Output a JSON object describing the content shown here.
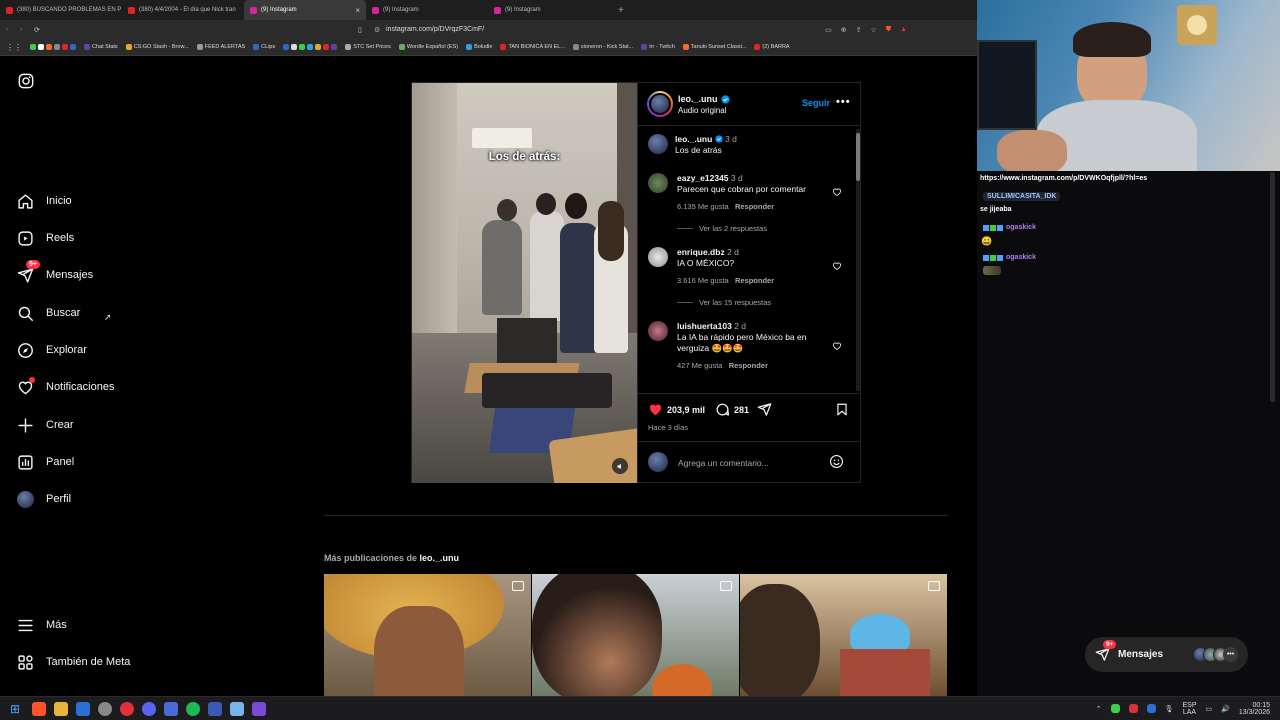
{
  "browser": {
    "tabs": [
      {
        "label": "(380) BUSCANDO PROBLEMAS EN P",
        "color": "#e02424"
      },
      {
        "label": "(380) 4/4/2004 - El día que Nick tran",
        "color": "#e02424"
      },
      {
        "label": "(9) Instagram",
        "color": "#d6249f",
        "active": true,
        "close": "×"
      },
      {
        "label": "(9) Instagram",
        "color": "#d6249f"
      },
      {
        "label": "(9) Instagram",
        "color": "#d6249f"
      }
    ],
    "new_tab": "+",
    "url": "instagram.com/p/DVrqzF3CmF/",
    "bookmarks": [
      "Chat Stats",
      "CS:GO Stash - Brow...",
      "FEED ALERTAS",
      "CLips",
      "STC Set Prices",
      "Wordle Español (ES)",
      "Boludle",
      "TAN BIONICA EN EL...",
      "sioneron - Kick Stat...",
      "trr - Twitch",
      "Tanuki Sunset Classi...",
      "(2) BARRA"
    ]
  },
  "sidebar": {
    "items": [
      {
        "label": "Inicio",
        "icon": "home-icon"
      },
      {
        "label": "Reels",
        "icon": "reels-icon"
      },
      {
        "label": "Mensajes",
        "icon": "messages-icon",
        "badge": "9+"
      },
      {
        "label": "Buscar",
        "icon": "search-icon"
      },
      {
        "label": "Explorar",
        "icon": "explore-icon"
      },
      {
        "label": "Notificaciones",
        "icon": "heart-icon"
      },
      {
        "label": "Crear",
        "icon": "plus-icon"
      },
      {
        "label": "Panel",
        "icon": "chart-icon"
      },
      {
        "label": "Perfil",
        "icon": "avatar"
      }
    ],
    "more": "Más",
    "meta": "También de Meta"
  },
  "post": {
    "overlay_text": "Los de atrás:",
    "author": "leo._.unu",
    "audio": "Audio original",
    "follow": "Seguir",
    "caption": {
      "user": "leo._.unu",
      "time": "3 d",
      "text": "Los de atrás"
    },
    "comments": [
      {
        "user": "eazy_e12345",
        "time": "3 d",
        "text": "Parecen que cobran por comentar",
        "likes": "6.135 Me gusta",
        "reply": "Responder",
        "replies": "Ver las 2 respuestas"
      },
      {
        "user": "enrique.dbz",
        "time": "2 d",
        "text": "IA O MÉXICO?",
        "likes": "3.616 Me gusta",
        "reply": "Responder",
        "replies": "Ver las 15 respuestas"
      },
      {
        "user": "luishuerta103",
        "time": "2 d",
        "text": "La IA ba rápido pero México ba en verguiza 🤩🤩🤩",
        "likes": "427 Me gusta",
        "reply": "Responder"
      }
    ],
    "likes": "203,9 mil",
    "comments_count": "281",
    "posted": "Hace 3 días",
    "comment_placeholder": "Agrega un comentario..."
  },
  "more_posts": {
    "prefix": "Más publicaciones de",
    "user": "leo._.unu"
  },
  "messages_bar": {
    "label": "Mensajes",
    "badge": "9+"
  },
  "stream": {
    "link": "https://www.instagram.com/p/DVWKOqfjpll/?hl=es",
    "chat": [
      {
        "user": "SULLIMICASITA_IDK",
        "message": "se jijeaba"
      },
      {
        "user": "ogaskick",
        "message": "😀"
      },
      {
        "user": "ogaskick",
        "message": ""
      }
    ]
  },
  "taskbar": {
    "lang": "ESP",
    "lang2": "LAA",
    "time": "00:15",
    "date": "13/3/2026"
  },
  "colors": {
    "accent": "#0095f6",
    "like": "#ff3040",
    "verified": "#0095f6",
    "chat_user": "#b37cf2"
  }
}
